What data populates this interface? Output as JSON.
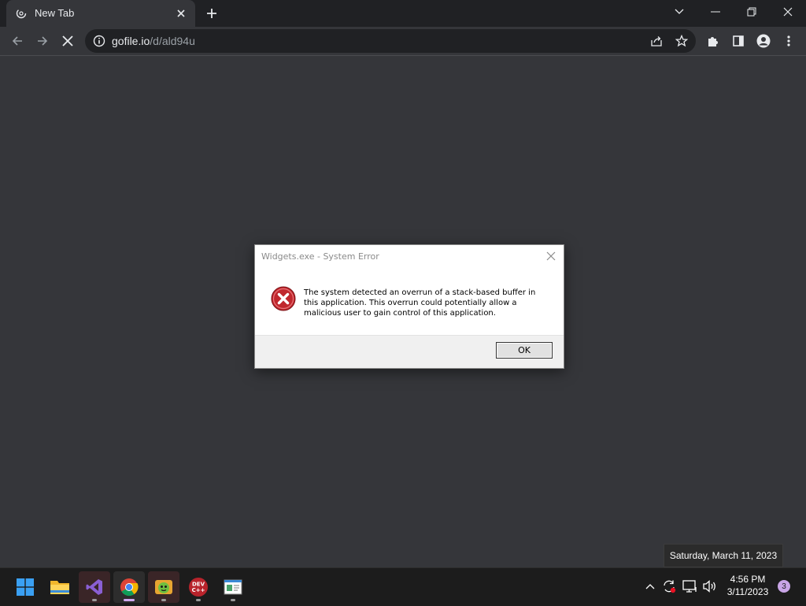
{
  "browser": {
    "tab": {
      "title": "New Tab",
      "favicon": "loading-globe-icon"
    },
    "window_controls": [
      "chevron-down-icon",
      "minimize-icon",
      "restore-icon",
      "close-icon"
    ],
    "url": {
      "host": "gofile.io",
      "path": "/d/ald94u"
    },
    "nav_icons": [
      "back-icon",
      "forward-icon",
      "stop-icon"
    ],
    "omnibox_icons": [
      "share-icon",
      "star-icon"
    ],
    "toolbar_icons": [
      "extensions-icon",
      "sidepanel-icon",
      "profile-icon",
      "menu-icon"
    ],
    "page_background": "#35363a"
  },
  "dialog": {
    "title": "Widgets.exe - System Error",
    "message": "The system detected an overrun of a stack-based buffer in this application. This overrun could potentially allow a malicious user to gain control of this application.",
    "ok_label": "OK",
    "icon": "error-icon"
  },
  "tooltip": {
    "text": "Saturday, March 11, 2023"
  },
  "taskbar": {
    "apps": [
      {
        "name": "start-button",
        "icon": "windows-logo-icon"
      },
      {
        "name": "file-explorer",
        "icon": "folder-icon"
      },
      {
        "name": "visual-studio",
        "icon": "visual-studio-icon"
      },
      {
        "name": "chrome",
        "icon": "chrome-icon"
      },
      {
        "name": "widgets-app",
        "icon": "widgets-app-icon"
      },
      {
        "name": "dev-cpp",
        "icon": "dev-cpp-icon",
        "label": "DEV C++"
      },
      {
        "name": "notepad",
        "icon": "notepad-icon"
      }
    ],
    "tray_icons": [
      "chevron-up-icon",
      "sync-icon",
      "network-icon",
      "volume-icon"
    ],
    "clock": {
      "time": "4:56 PM",
      "date": "3/11/2023"
    },
    "notifications": "3"
  }
}
